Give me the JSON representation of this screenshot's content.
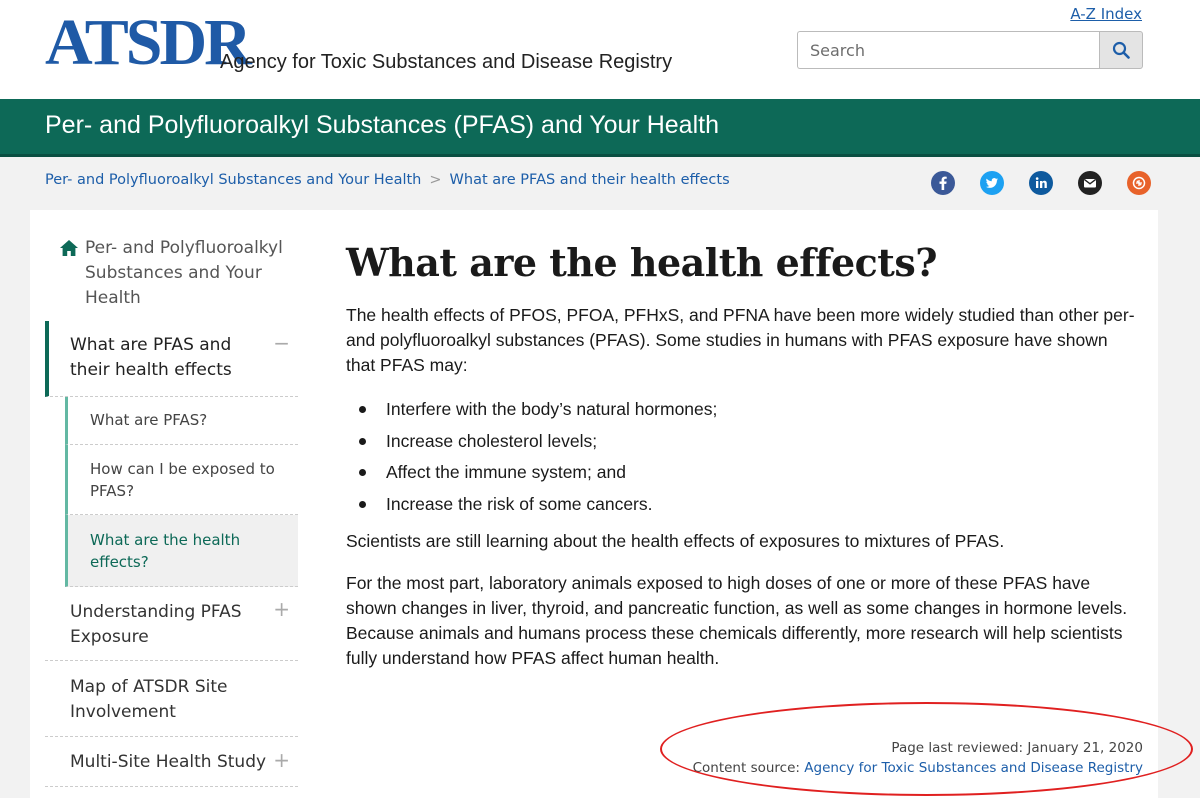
{
  "header": {
    "logo": "ATSDR",
    "agency_name": "Agency for Toxic Substances and Disease Registry",
    "az_index": "A-Z Index",
    "search_placeholder": "Search"
  },
  "banner": {
    "title": "Per- and Polyfluoroalkyl Substances (PFAS) and Your Health"
  },
  "breadcrumb": {
    "items": [
      "Per- and Polyfluoroalkyl Substances and Your Health",
      "What are PFAS and their health effects"
    ],
    "separator": ">"
  },
  "social_icons": [
    "facebook-icon",
    "twitter-icon",
    "linkedin-icon",
    "email-icon",
    "syndicate-icon"
  ],
  "sidebar": {
    "home_label": "Per- and Polyfluoroalkyl Substances and Your Health",
    "items": [
      {
        "label": "What are PFAS and their health effects",
        "toggle": "−",
        "expanded": true,
        "children": [
          "What are PFAS?",
          "How can I be exposed to PFAS?",
          "What are the health effects?"
        ]
      },
      {
        "label": "Understanding PFAS Exposure",
        "toggle": "+"
      },
      {
        "label": "Map of ATSDR Site Involvement"
      },
      {
        "label": "Multi-Site Health Study",
        "toggle": "+"
      }
    ]
  },
  "main": {
    "title": "What are the health effects?",
    "intro": "The health effects of PFOS, PFOA, PFHxS, and PFNA have been more widely studied than other per- and polyfluoroalkyl substances (PFAS). Some studies in humans with PFAS exposure have shown that PFAS may:",
    "bullets": [
      "Interfere with the body’s natural hormones;",
      "Increase cholesterol levels;",
      "Affect the immune system; and",
      "Increase the risk of some cancers."
    ],
    "para2": "Scientists are still learning about the health effects of exposures to mixtures of PFAS.",
    "para3": "For the most part, laboratory animals exposed to high doses of one or more of these PFAS have shown changes in liver, thyroid, and pancreatic function, as well as some changes in hormone levels. Because animals and humans process these chemicals differently, more research will help scientists fully understand how PFAS affect human health."
  },
  "footer": {
    "last_reviewed": "Page last reviewed: January 21, 2020",
    "content_source_label": "Content source:",
    "content_source_link": "Agency for Toxic Substances and Disease Registry"
  },
  "colors": {
    "brand_green": "#0d6957",
    "link_blue": "#1d5ea9",
    "logo_blue": "#1f5aa6",
    "annotation_red": "#e02020"
  }
}
